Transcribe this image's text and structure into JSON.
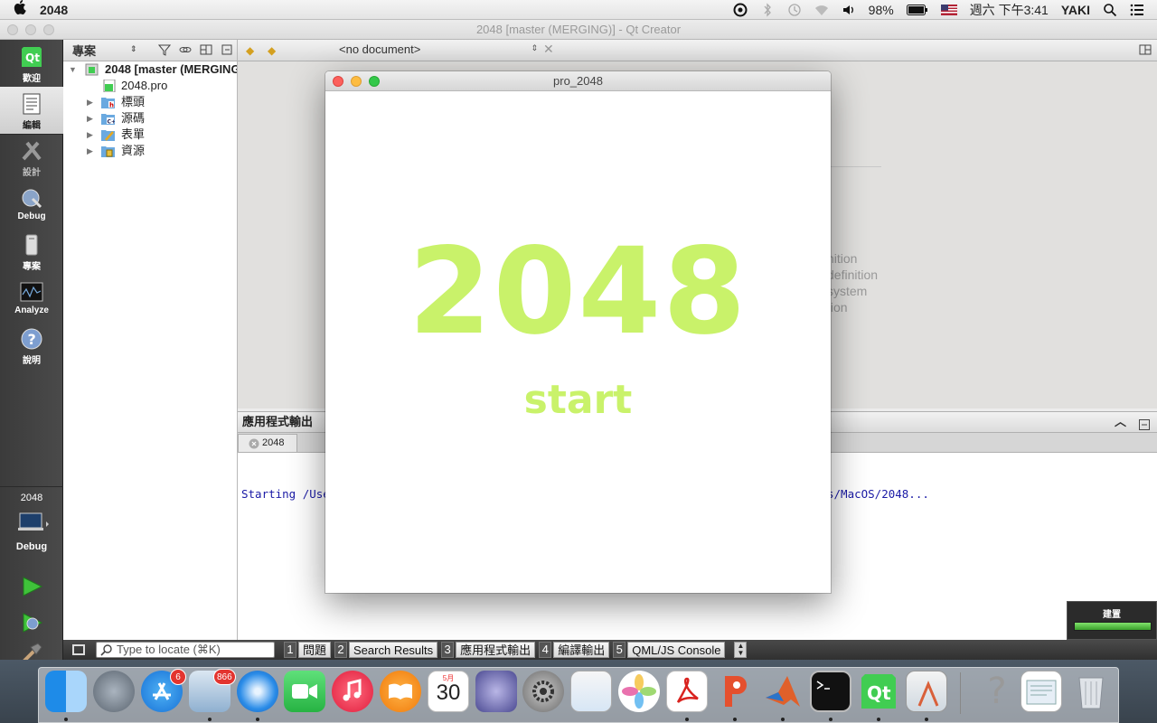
{
  "menubar": {
    "app_name": "2048",
    "battery": "98%",
    "datetime": "週六 下午3:41",
    "user": "YAKI"
  },
  "main_window": {
    "title": "2048 [master (MERGING)] - Qt Creator"
  },
  "modes": {
    "welcome": "歡迎",
    "edit": "編輯",
    "design": "設計",
    "debug": "Debug",
    "projects": "專案",
    "analyze": "Analyze",
    "help": "說明",
    "kit_project": "2048",
    "kit_build": "Debug"
  },
  "project_panel": {
    "title": "專案",
    "root": "2048 [master (MERGING)]",
    "items": [
      {
        "label": "2048.pro"
      },
      {
        "label": "標頭"
      },
      {
        "label": "源碼"
      },
      {
        "label": "表單"
      },
      {
        "label": "資源"
      }
    ]
  },
  "editor": {
    "document": "<no document>",
    "background_lines": [
      "nition",
      "definition",
      "system",
      "tion"
    ]
  },
  "output": {
    "title": "應用程式輸出",
    "tab": "2048",
    "line_prefix": "Starting /Use",
    "line_suffix": "s/MacOS/2048..."
  },
  "statusbar": {
    "locate_placeholder": "Type to locate (⌘K)",
    "panes": [
      {
        "num": "1",
        "label": "問題"
      },
      {
        "num": "2",
        "label": "Search Results"
      },
      {
        "num": "3",
        "label": "應用程式輸出"
      },
      {
        "num": "4",
        "label": "編譯輸出"
      },
      {
        "num": "5",
        "label": "QML/JS Console"
      }
    ],
    "build_label": "建置",
    "build_progress": 1.0
  },
  "game_window": {
    "title": "pro_2048",
    "headline": "2048",
    "start_label": "start",
    "accent_color": "#c9f26a"
  },
  "dock": {
    "items": [
      {
        "name": "finder"
      },
      {
        "name": "launchpad"
      },
      {
        "name": "app-store",
        "badge": "6"
      },
      {
        "name": "mail",
        "badge": "866"
      },
      {
        "name": "safari"
      },
      {
        "name": "facetime"
      },
      {
        "name": "itunes"
      },
      {
        "name": "ibooks"
      },
      {
        "name": "calendar",
        "month": "5月",
        "day": "30"
      },
      {
        "name": "script-editor"
      },
      {
        "name": "system-preferences"
      },
      {
        "name": "preview"
      },
      {
        "name": "photos"
      },
      {
        "name": "acrobat"
      },
      {
        "name": "powerpoint"
      },
      {
        "name": "matlab"
      },
      {
        "name": "terminal"
      },
      {
        "name": "qt-creator"
      },
      {
        "name": "xcode-instruments"
      },
      {
        "name": "help"
      },
      {
        "name": "documents-stack"
      },
      {
        "name": "trash"
      }
    ]
  }
}
